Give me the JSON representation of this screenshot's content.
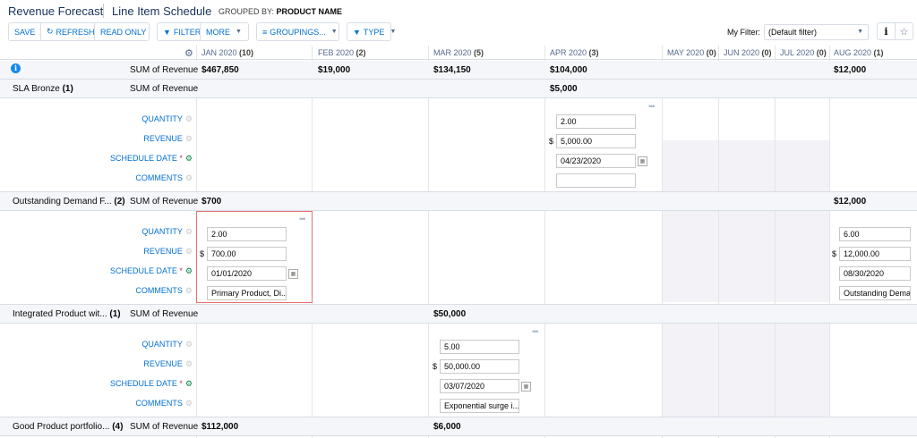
{
  "title": {
    "app": "Revenue Forecast",
    "page": "Line Item Schedule",
    "grouped_prefix": "GROUPED BY:",
    "grouped_value": "PRODUCT NAME"
  },
  "toolbar": {
    "save": "SAVE",
    "refresh": "REFRESH",
    "readonly": "READ ONLY",
    "filter": "FILTER",
    "more": "MORE",
    "groupings": "GROUPINGS...",
    "type": "TYPE",
    "myfilter_label": "My Filter:",
    "myfilter_value": "(Default filter)"
  },
  "columns": [
    {
      "month": "JAN 2020",
      "count": "(10)"
    },
    {
      "month": "FEB 2020",
      "count": "(2)"
    },
    {
      "month": "MAR 2020",
      "count": "(5)"
    },
    {
      "month": "APR 2020",
      "count": "(3)"
    },
    {
      "month": "MAY 2020",
      "count": "(0)"
    },
    {
      "month": "JUN 2020",
      "count": "(0)"
    },
    {
      "month": "JUL 2020",
      "count": "(0)"
    },
    {
      "month": "AUG 2020",
      "count": "(1)"
    }
  ],
  "total_row": {
    "label": "SUM of Revenue",
    "values": [
      "$467,850",
      "$19,000",
      "$134,150",
      "$104,000",
      "",
      "",
      "",
      "$12,000"
    ]
  },
  "field_labels": {
    "quantity": "QUANTITY",
    "revenue": "REVENUE",
    "schedule_date": "SCHEDULE DATE",
    "required_mark": "*",
    "comments": "COMMENTS",
    "currency": "$"
  },
  "groups": [
    {
      "name": "SLA Bronze",
      "count": "(1)",
      "sum_label": "SUM of Revenue",
      "sums": {
        "apr": "$5,000"
      },
      "cells": {
        "apr": {
          "quantity": "2.00",
          "revenue": "5,000.00",
          "date": "04/23/2020",
          "comments": ""
        }
      }
    },
    {
      "name": "Outstanding Demand F...",
      "count": "(2)",
      "sum_label": "SUM of Revenue",
      "sums": {
        "jan": "$700",
        "aug": "$12,000"
      },
      "cells": {
        "jan": {
          "quantity": "2.00",
          "revenue": "700.00",
          "date": "01/01/2020",
          "comments": "Primary Product, Di..."
        },
        "aug": {
          "quantity": "6.00",
          "revenue": "12,000.00",
          "date": "08/30/2020",
          "comments": "Outstanding Dema..."
        }
      }
    },
    {
      "name": "Integrated Product wit...",
      "count": "(1)",
      "sum_label": "SUM of Revenue",
      "sums": {
        "mar": "$50,000"
      },
      "cells": {
        "mar": {
          "quantity": "5.00",
          "revenue": "50,000.00",
          "date": "03/07/2020",
          "comments": "Exponential surge i..."
        }
      }
    },
    {
      "name": "Good Product portfolio...",
      "count": "(4)",
      "sum_label": "SUM of Revenue",
      "sums": {
        "jan": "$112,000",
        "mar": "$6,000"
      }
    }
  ],
  "colors": {
    "link": "#0070d2",
    "header_bg": "#f4f6f9",
    "highlight": "#e57373",
    "empty_shade": "#f3f3f7"
  }
}
